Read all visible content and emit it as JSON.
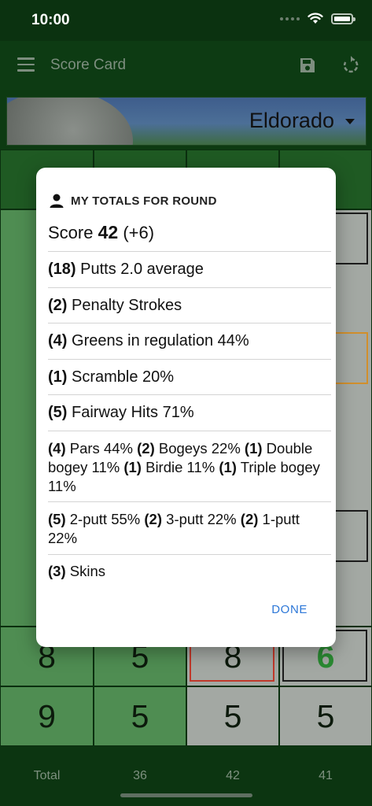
{
  "status_bar": {
    "time": "10:00"
  },
  "app_bar": {
    "title": "Score Card",
    "icons": [
      "menu-icon",
      "save-icon",
      "refresh-icon"
    ]
  },
  "course": {
    "name": "Eldorado"
  },
  "grid_rows": [
    {
      "values": [
        "8",
        "5",
        "8",
        "6"
      ],
      "highlight": [
        null,
        null,
        "red-border",
        "green-text"
      ]
    },
    {
      "values": [
        "9",
        "5",
        "5",
        "5"
      ],
      "highlight": [
        null,
        null,
        null,
        null
      ]
    }
  ],
  "footer": {
    "label": "Total",
    "totals": [
      "36",
      "42",
      "41"
    ]
  },
  "dialog": {
    "heading": "MY TOTALS FOR ROUND",
    "score_label": "Score",
    "score_value": "42",
    "score_delta": "(+6)",
    "putts": {
      "count": "(18)",
      "text": "Putts 2.0 average"
    },
    "penalty": {
      "count": "(2)",
      "text": "Penalty Strokes"
    },
    "greens": {
      "count": "(4)",
      "text": "Greens in regulation 44%"
    },
    "scramble": {
      "count": "(1)",
      "text": "Scramble 20%"
    },
    "fairway": {
      "count": "(5)",
      "text": "Fairway Hits 71%"
    },
    "results": [
      {
        "count": "(4)",
        "text": "Pars 44%"
      },
      {
        "count": "(2)",
        "text": "Bogeys 22%"
      },
      {
        "count": "(1)",
        "text": "Double bogey 11%"
      },
      {
        "count": "(1)",
        "text": "Birdie 11%"
      },
      {
        "count": "(1)",
        "text": "Triple bogey 11%"
      }
    ],
    "putt_types": [
      {
        "count": "(5)",
        "text": "2-putt 55%"
      },
      {
        "count": "(2)",
        "text": "3-putt 22%"
      },
      {
        "count": "(2)",
        "text": "1-putt 22%"
      }
    ],
    "skins": {
      "count": "(3)",
      "text": "Skins"
    },
    "done_label": "DONE"
  },
  "colors": {
    "accent": "#2d78d8",
    "app_bar": "#0d3b13",
    "green_cell": "#4f8d52",
    "grey_cell": "#a3a8a3"
  }
}
